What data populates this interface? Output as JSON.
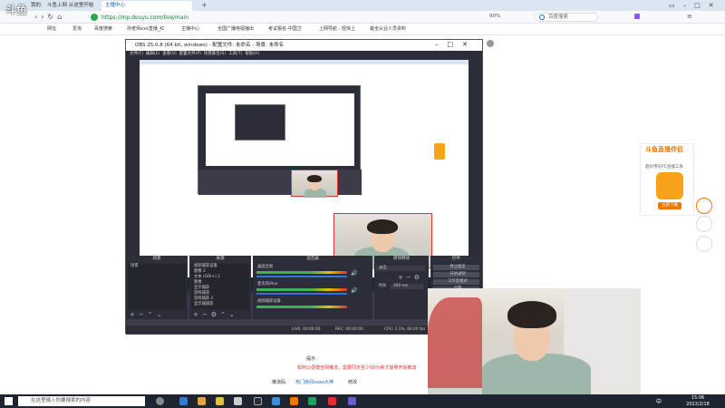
{
  "browser": {
    "tabs": [
      {
        "label": "我的主页"
      },
      {
        "label": "斗鱼上网 从这里开始"
      },
      {
        "label": "主播中心"
      }
    ],
    "url": "https://mp.douyu.com/live/main",
    "zoom": "90%",
    "search_placeholder": "百度搜索",
    "bookmarks": [
      "网址",
      "爱淘",
      "百度搜索",
      "孙老师xxx直播_红",
      "主播中心",
      "全国广播电视播出",
      "考试报名-中国卫",
      "上网导航 - 轻快上",
      "最全从业人员资料"
    ]
  },
  "watermark": "斗鱼",
  "obs": {
    "title": "OBS 25.0.8 (64 bit, windows) - 配置文件: 未命名 - 场景: 未命名",
    "menu": [
      "文件(F)",
      "编辑(E)",
      "查看(V)",
      "配置文件(P)",
      "场景集合(S)",
      "工具(T)",
      "帮助(H)"
    ],
    "docks": {
      "scenes": "场景",
      "sources": "来源",
      "mixer": "混音器",
      "transitions": "转场特效",
      "controls": "控件"
    },
    "scene_list": [
      "场景"
    ],
    "source_list": [
      "视频捕获设备",
      "图像 2",
      "文本 (GDI+) 2",
      "图像",
      "显示捕获",
      "游戏捕获",
      "游戏捕获 2",
      "显示器捕获"
    ],
    "mixer_channels": [
      "桌面音频",
      "麦克风/Aux",
      "视频捕获设备"
    ],
    "transition": "淡出",
    "duration_label": "时长",
    "duration": "300 ms",
    "control_buttons": [
      "停止推流",
      "开始录制",
      "工作室模式",
      "设置",
      "退出"
    ],
    "status": {
      "live": "LIVE: 00:00:00",
      "rec": "REC: 00:00:00",
      "cpu": "CPU: 2.1%, 60.00 fps"
    }
  },
  "page": {
    "prompt": "提示",
    "line1": "如何以便捷全网推流，需要同步至少50分钟才能够开始推流",
    "push_label": "推流码:",
    "push_link": "热门房间xxxx大神",
    "modify": "修改"
  },
  "ad": {
    "title": "斗鱼直播伴侣",
    "subtitle": "超好用的PC直播工具",
    "button": "立即下载"
  },
  "taskbar": {
    "search": "在这里输入你要搜索的内容",
    "ime": "中",
    "time": "15:06",
    "date": "2022/2/18"
  }
}
